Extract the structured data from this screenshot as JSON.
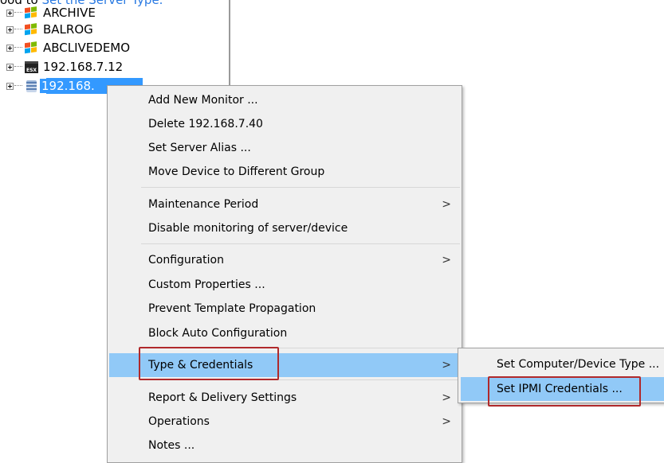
{
  "top_text": {
    "prefix": "ood to ",
    "link": "Set the Server Type."
  },
  "tree": {
    "nodes": [
      {
        "label": "ARCHIVE",
        "icon": "windows-icon"
      },
      {
        "label": "BALROG",
        "icon": "windows-icon"
      },
      {
        "label": "ABCLIVEDEMO",
        "icon": "windows-icon"
      },
      {
        "label": "192.168.7.12",
        "icon": "esx-icon",
        "icon_text": "ESX"
      },
      {
        "label": "192.168.",
        "icon": "database-icon",
        "selected": true
      }
    ]
  },
  "menu": {
    "items": [
      {
        "label": "Add New Monitor ..."
      },
      {
        "label": "Delete 192.168.7.40"
      },
      {
        "label": "Set Server Alias ..."
      },
      {
        "label": "Move Device to Different Group"
      },
      {
        "label": "Maintenance Period",
        "arrow": ">"
      },
      {
        "label": "Disable monitoring of server/device"
      },
      {
        "label": "Configuration",
        "arrow": ">"
      },
      {
        "label": "Custom Properties ..."
      },
      {
        "label": "Prevent Template Propagation"
      },
      {
        "label": "Block Auto Configuration"
      },
      {
        "label": "Type & Credentials",
        "arrow": ">"
      },
      {
        "label": "Report & Delivery Settings",
        "arrow": ">"
      },
      {
        "label": "Operations",
        "arrow": ">"
      },
      {
        "label": "Notes ..."
      }
    ]
  },
  "submenu": {
    "items": [
      {
        "label": "Set Computer/Device Type ..."
      },
      {
        "label": "Set IPMI Credentials ..."
      }
    ]
  },
  "colors": {
    "highlight": "#91c9f7",
    "selection": "#3399ff",
    "annotation_box": "#b0292b"
  }
}
